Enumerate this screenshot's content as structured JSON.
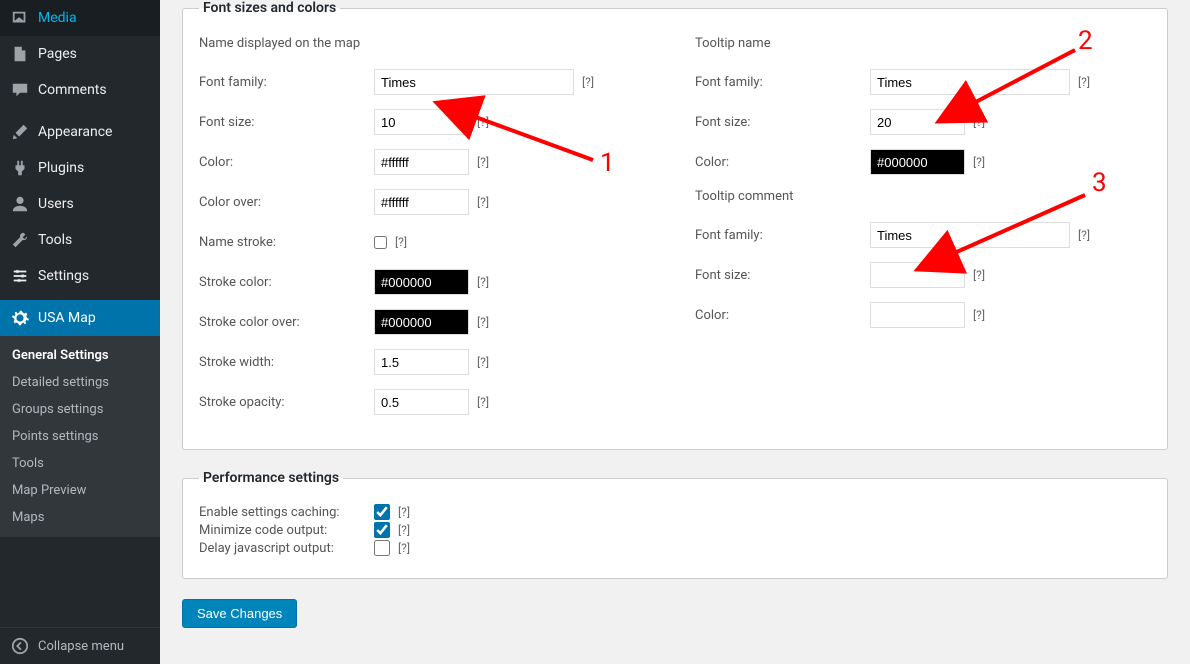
{
  "sidebar": {
    "items": [
      {
        "label": "Media",
        "icon": "media"
      },
      {
        "label": "Pages",
        "icon": "page"
      },
      {
        "label": "Comments",
        "icon": "comment"
      },
      {
        "label": "Appearance",
        "icon": "brush"
      },
      {
        "label": "Plugins",
        "icon": "plug"
      },
      {
        "label": "Users",
        "icon": "user"
      },
      {
        "label": "Tools",
        "icon": "wrench"
      },
      {
        "label": "Settings",
        "icon": "sliders"
      },
      {
        "label": "USA Map",
        "icon": "gear",
        "active": true
      }
    ],
    "submenu": [
      "General Settings",
      "Detailed settings",
      "Groups settings",
      "Points settings",
      "Tools",
      "Map Preview",
      "Maps"
    ],
    "submenu_current": 0,
    "collapse_label": "Collapse menu"
  },
  "fieldset1_legend": "Font sizes and colors",
  "left": {
    "heading": "Name displayed on the map",
    "fields": {
      "font_family": {
        "label": "Font family:",
        "value": "Times"
      },
      "font_size": {
        "label": "Font size:",
        "value": "10"
      },
      "color": {
        "label": "Color:",
        "value": "#ffffff"
      },
      "color_over": {
        "label": "Color over:",
        "value": "#ffffff"
      },
      "name_stroke": {
        "label": "Name stroke:",
        "value": ""
      },
      "stroke_color": {
        "label": "Stroke color:",
        "value": "#000000"
      },
      "stroke_color_over": {
        "label": "Stroke color over:",
        "value": "#000000"
      },
      "stroke_width": {
        "label": "Stroke width:",
        "value": "1.5"
      },
      "stroke_opacity": {
        "label": "Stroke opacity:",
        "value": "0.5"
      }
    }
  },
  "right": {
    "heading1": "Tooltip name",
    "tt_name": {
      "font_family": {
        "label": "Font family:",
        "value": "Times"
      },
      "font_size": {
        "label": "Font size:",
        "value": "20"
      },
      "color": {
        "label": "Color:",
        "value": "#000000"
      }
    },
    "heading2": "Tooltip comment",
    "tt_comment": {
      "font_family": {
        "label": "Font family:",
        "value": "Times"
      },
      "font_size": {
        "label": "Font size:",
        "value": ""
      },
      "color": {
        "label": "Color:",
        "value": ""
      }
    }
  },
  "fieldset2_legend": "Performance settings",
  "perf": {
    "caching": {
      "label": "Enable settings caching:",
      "checked": true
    },
    "minimize": {
      "label": "Minimize code output:",
      "checked": true
    },
    "delay": {
      "label": "Delay javascript output:",
      "checked": false
    }
  },
  "help_text": "[?]",
  "save_label": "Save Changes",
  "annotations": {
    "n1": "1",
    "n2": "2",
    "n3": "3"
  }
}
